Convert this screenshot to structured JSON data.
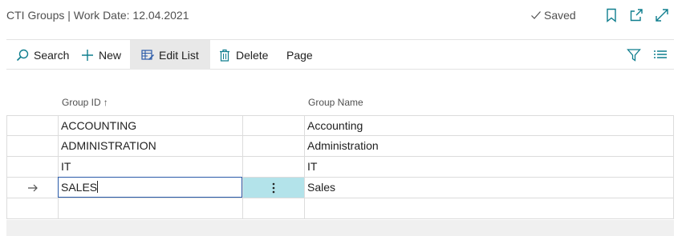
{
  "header": {
    "title": "CTI Groups | Work Date: 12.04.2021",
    "saved_label": "Saved"
  },
  "toolbar": {
    "search_label": "Search",
    "new_label": "New",
    "edit_list_label": "Edit List",
    "delete_label": "Delete",
    "page_label": "Page"
  },
  "columns": {
    "group_id": "Group ID",
    "group_id_sort": "↑",
    "group_name": "Group Name"
  },
  "rows": [
    {
      "group_id": "ACCOUNTING",
      "group_name": "Accounting"
    },
    {
      "group_id": "ADMINISTRATION",
      "group_name": "Administration"
    },
    {
      "group_id": "IT",
      "group_name": "IT"
    },
    {
      "group_id": "SALES",
      "group_name": "Sales"
    }
  ],
  "colors": {
    "accent": "#2a5aa8",
    "selected_cell": "#b3e3ea",
    "icon_teal": "#0f7e8e"
  }
}
